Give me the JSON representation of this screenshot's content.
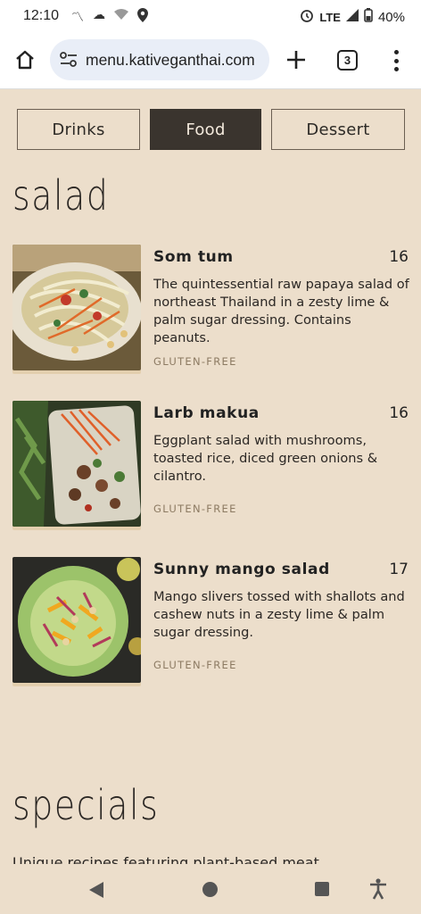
{
  "status_bar": {
    "time": "12:10",
    "network": "LTE",
    "battery": "40%"
  },
  "browser": {
    "url": "menu.kativeganthai.com",
    "tab_count": "3"
  },
  "category_tabs": [
    {
      "label": "Drinks",
      "active": false
    },
    {
      "label": "Food",
      "active": true
    },
    {
      "label": "Dessert",
      "active": false
    }
  ],
  "sections": {
    "salad": {
      "title": "salad",
      "items": [
        {
          "name": "Som tum",
          "price": "16",
          "description": "The quintessential raw papaya salad of northeast Thailand in a zesty lime & palm sugar dressing. Contains peanuts.",
          "tag": "GLUTEN-FREE",
          "image": "papaya-salad-photo"
        },
        {
          "name": "Larb makua",
          "price": "16",
          "description": "Eggplant salad with mushrooms, toasted rice, diced green onions & cilantro.",
          "tag": "GLUTEN-FREE",
          "image": "eggplant-salad-photo"
        },
        {
          "name": "Sunny mango salad",
          "price": "17",
          "description": "Mango slivers tossed with shallots and cashew nuts in a zesty lime & palm sugar dressing.",
          "tag": "GLUTEN-FREE",
          "image": "mango-salad-photo"
        }
      ]
    },
    "specials": {
      "title": "specials",
      "subtitle": "Unique recipes featuring plant-based meat"
    }
  },
  "colors": {
    "background": "#ecdecb",
    "active_tab": "#3a342e",
    "tag": "#8c7a62"
  }
}
